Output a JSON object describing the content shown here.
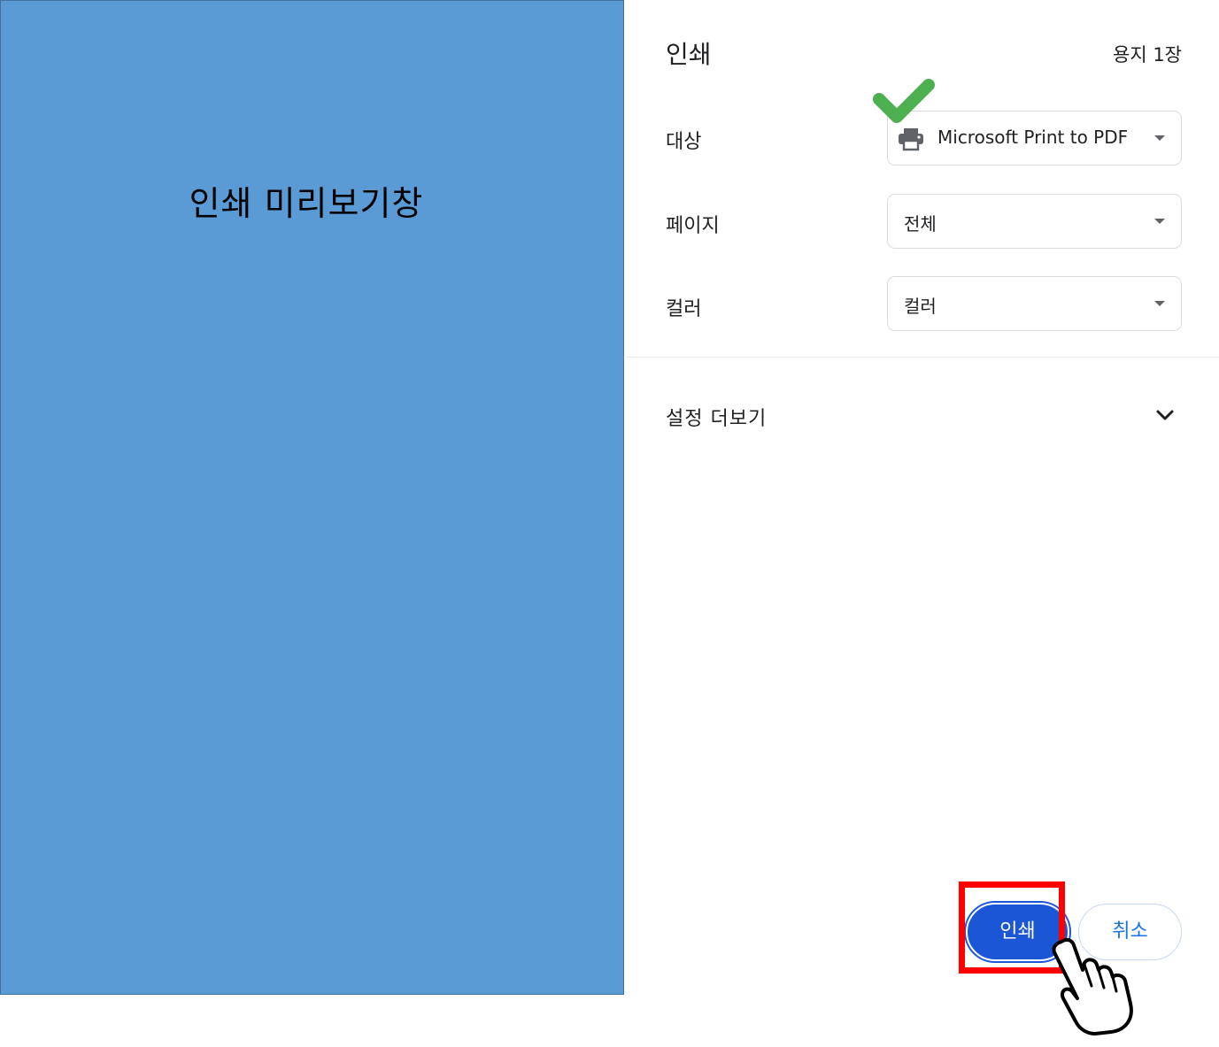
{
  "preview": {
    "label": "인쇄 미리보기창",
    "background": "#5b9bd5"
  },
  "panel": {
    "title": "인쇄",
    "sheet_count": "용지 1장",
    "destination": {
      "label": "대상",
      "value": "Microsoft Print to PDF",
      "icon": "printer-icon"
    },
    "pages": {
      "label": "페이지",
      "value": "전체"
    },
    "color": {
      "label": "컬러",
      "value": "컬러"
    },
    "more_settings": {
      "label": "설정 더보기",
      "icon": "chevron-down-icon"
    }
  },
  "actions": {
    "print_label": "인쇄",
    "cancel_label": "취소"
  },
  "annotations": {
    "check_icon": "check-icon",
    "check_color": "#4caf50",
    "highlight_color": "#ff0000",
    "pointer_icon": "hand-pointer-icon"
  },
  "colors": {
    "accent": "#1a56d6",
    "cancel_text": "#1a73e8"
  }
}
